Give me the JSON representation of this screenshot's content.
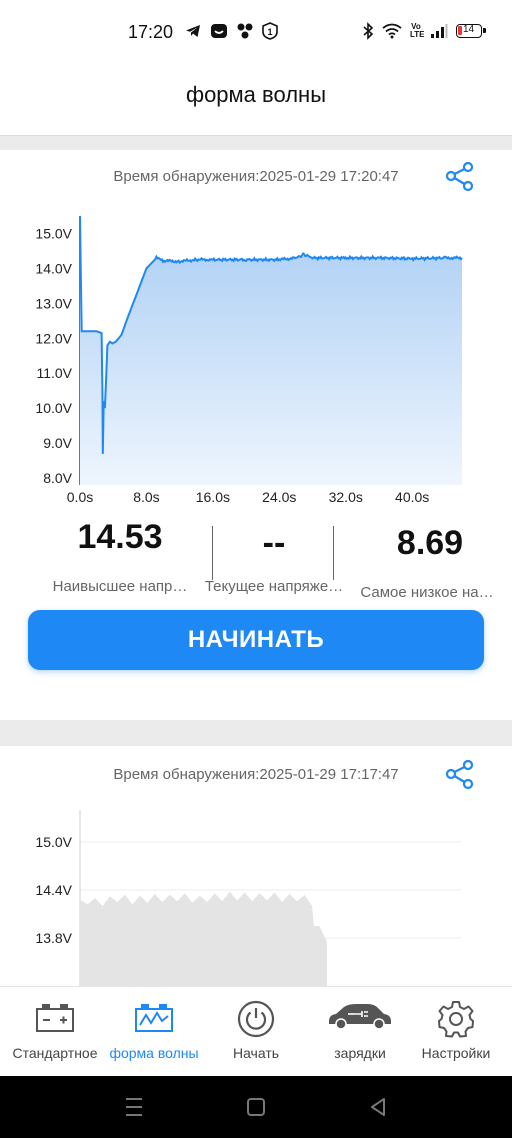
{
  "status_bar": {
    "time": "17:20",
    "left_icons": [
      "telegram-icon",
      "sim-toolkit-icon",
      "fan-icon",
      "notification-1-icon"
    ],
    "right_icons": [
      "bluetooth-icon",
      "wifi-icon",
      "volte-icon",
      "signal-icon",
      "battery-icon"
    ],
    "volte_label": "Vo LTE",
    "battery_level": "14"
  },
  "header": {
    "title": "форма волны"
  },
  "card1": {
    "detect_time": "Время обнаружения:2025-01-29 17:20:47",
    "share_icon": "share-icon",
    "stats": {
      "highest_value": "14.53",
      "highest_label": "Наивысшее напр…",
      "current_value": "--",
      "current_label": "Текущее напряже…",
      "lowest_value": "8.69",
      "lowest_label": "Самое низкое на…"
    },
    "start_button": "НАЧИНАТЬ"
  },
  "card2": {
    "detect_time": "Время обнаружения:2025-01-29 17:17:47",
    "share_icon": "share-icon"
  },
  "tabs": [
    {
      "label": "Стандартное",
      "icon": "battery-icon",
      "active": false
    },
    {
      "label": "форма волны",
      "icon": "waveform-icon",
      "active": true
    },
    {
      "label": "Начать",
      "icon": "power-icon",
      "active": false
    },
    {
      "label": "зарядки",
      "icon": "car-charging-icon",
      "active": false
    },
    {
      "label": "Настройки",
      "icon": "gear-icon",
      "active": false
    }
  ],
  "colors": {
    "accent": "#1e88f5",
    "chart_line": "#1e88f5",
    "chart_fill": "#c2dcf6",
    "inactive_tab": "#444444",
    "gray_fill": "#e4e4e4"
  },
  "chart_data": [
    {
      "type": "area",
      "xlabel": "",
      "ylabel": "",
      "xlim": [
        0,
        46
      ],
      "ylim": [
        8,
        15
      ],
      "x_ticks": [
        "0.0s",
        "8.0s",
        "16.0s",
        "24.0s",
        "32.0s",
        "40.0s"
      ],
      "y_ticks": [
        "15.0V",
        "14.0V",
        "13.0V",
        "12.0V",
        "11.0V",
        "10.0V",
        "9.0V",
        "8.0V"
      ],
      "grid": false,
      "series": [
        {
          "x": [
            0,
            0.2,
            1,
            2,
            2.6,
            2.7,
            2.75,
            2.85,
            3.0,
            3.3,
            3.6,
            3.9,
            4.3,
            5.0,
            5.6,
            6.4,
            7.2,
            8.0,
            8.8,
            9.2,
            10,
            12,
            14,
            16,
            20,
            24,
            26,
            27,
            28,
            32,
            36,
            40,
            44,
            46
          ],
          "y": [
            15.5,
            12.2,
            12.2,
            12.2,
            12.15,
            10.5,
            8.69,
            10.2,
            10.0,
            11.8,
            11.9,
            11.85,
            11.9,
            12.1,
            12.5,
            13.0,
            13.5,
            14.0,
            14.2,
            14.3,
            14.22,
            14.2,
            14.25,
            14.25,
            14.25,
            14.25,
            14.3,
            14.4,
            14.3,
            14.3,
            14.3,
            14.28,
            14.3,
            14.3
          ]
        }
      ]
    },
    {
      "type": "area",
      "xlabel": "",
      "ylabel": "",
      "ylim": [
        13.8,
        15.0
      ],
      "y_ticks": [
        "15.0V",
        "14.4V",
        "13.8V"
      ],
      "grid": true,
      "series": [
        {
          "x": [
            0,
            2,
            4,
            6,
            8,
            10,
            12,
            14,
            16,
            18,
            20,
            22,
            24,
            26,
            28,
            30,
            32,
            34,
            36,
            38,
            40,
            42,
            44,
            46,
            48,
            50,
            52,
            54,
            56,
            58,
            60,
            62,
            62.5,
            64,
            66
          ],
          "y": [
            14.28,
            14.22,
            14.3,
            14.2,
            14.32,
            14.25,
            14.34,
            14.22,
            14.33,
            14.24,
            14.35,
            14.25,
            14.34,
            14.26,
            14.36,
            14.24,
            14.33,
            14.25,
            14.36,
            14.26,
            14.38,
            14.27,
            14.37,
            14.26,
            14.36,
            14.27,
            14.37,
            14.25,
            14.35,
            14.26,
            14.34,
            14.2,
            13.95,
            13.95,
            13.75
          ]
        }
      ]
    }
  ]
}
